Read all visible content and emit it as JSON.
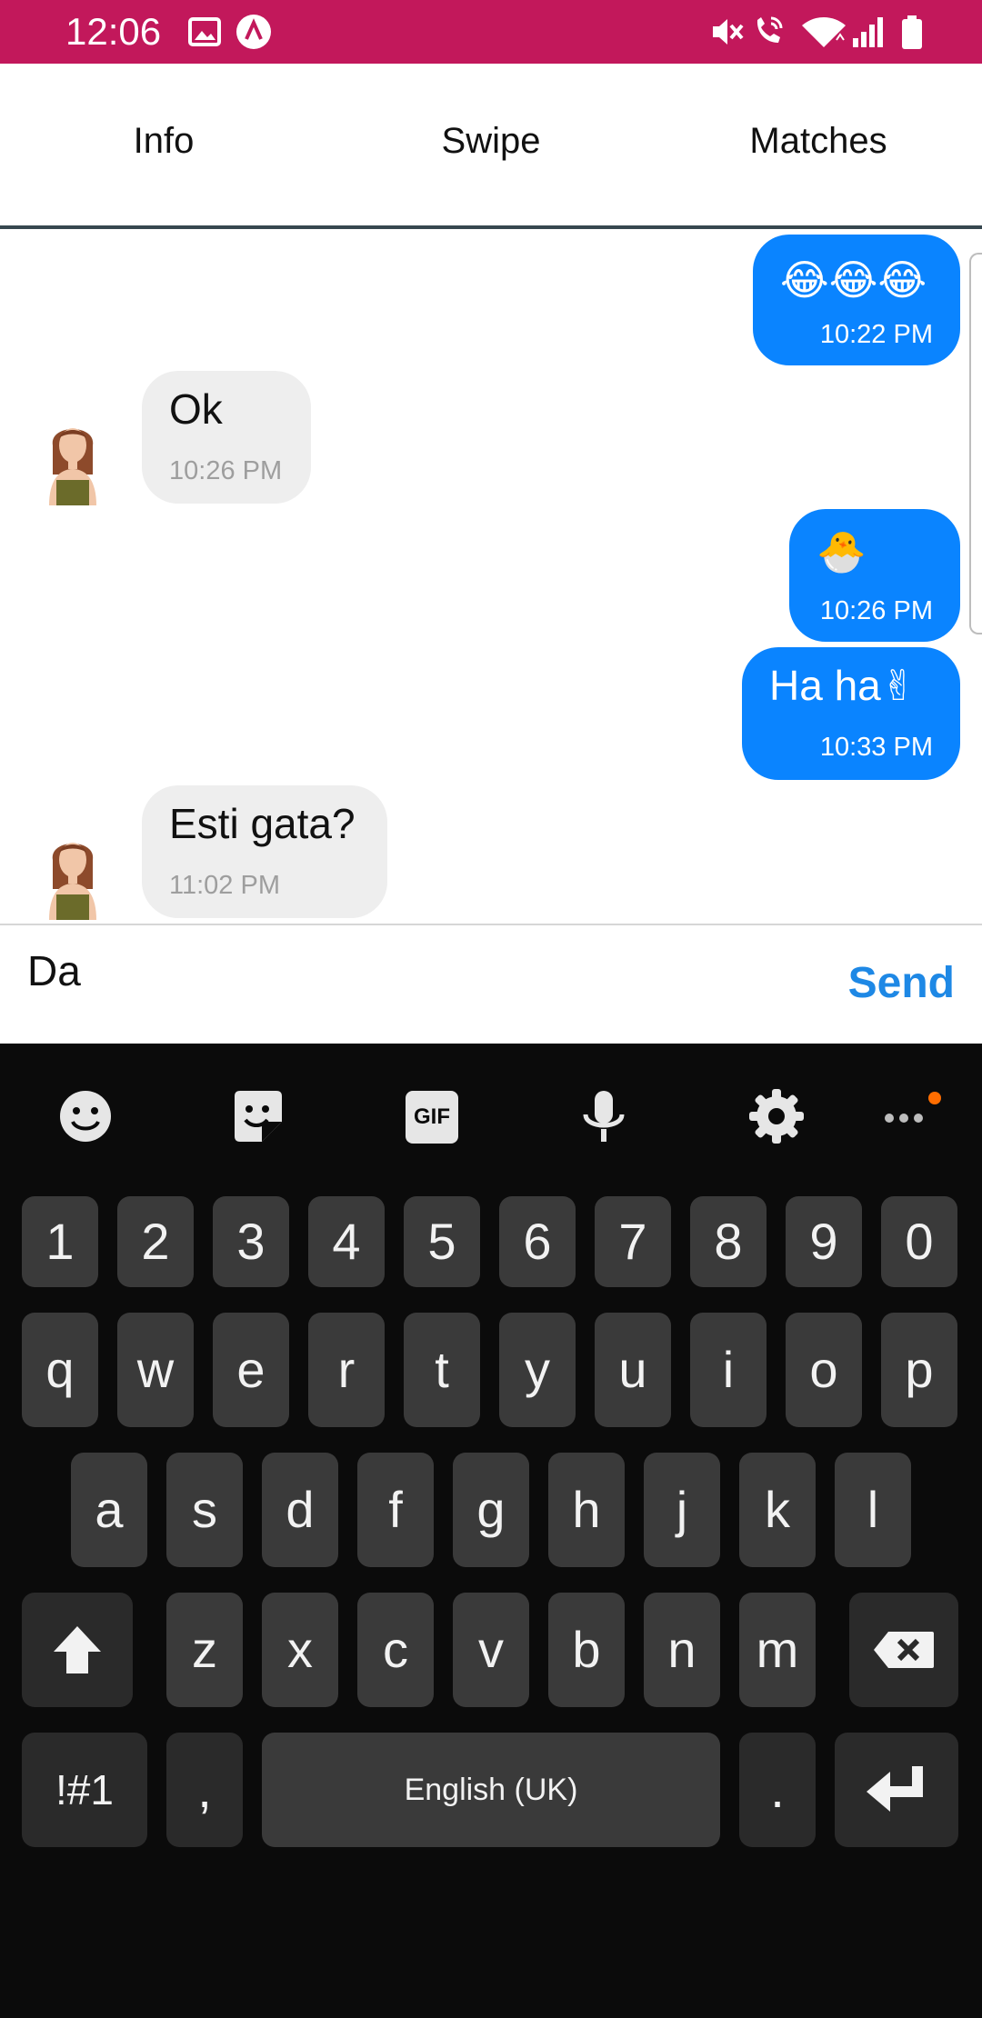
{
  "status_bar": {
    "time": "12:06",
    "color": "#c2185b",
    "icons": [
      "image-icon",
      "autocorrect-a-icon",
      "mute-icon",
      "wifi-calling-icon",
      "wifi-icon",
      "signal-icon",
      "battery-icon"
    ]
  },
  "tabs": [
    {
      "label": "Info"
    },
    {
      "label": "Swipe"
    },
    {
      "label": "Matches"
    }
  ],
  "messages": [
    {
      "direction": "sent",
      "text": "😂😂😂",
      "time": "10:22 PM"
    },
    {
      "direction": "received",
      "text": "Ok",
      "time": "10:26 PM"
    },
    {
      "direction": "sent",
      "text": "🐣",
      "time": "10:26 PM"
    },
    {
      "direction": "sent",
      "text": "Ha ha✌",
      "time": "10:33 PM"
    },
    {
      "direction": "received",
      "text": "Esti gata?",
      "time": "11:02 PM"
    }
  ],
  "compose": {
    "value": "Da",
    "send_label": "Send"
  },
  "keyboard": {
    "toolbar": [
      "emoji-icon",
      "sticker-icon",
      "gif-icon",
      "microphone-icon",
      "settings-icon",
      "more-icon"
    ],
    "gif_label": "GIF",
    "number_row": [
      "1",
      "2",
      "3",
      "4",
      "5",
      "6",
      "7",
      "8",
      "9",
      "0"
    ],
    "row1": [
      "q",
      "w",
      "e",
      "r",
      "t",
      "y",
      "u",
      "i",
      "o",
      "p"
    ],
    "row2": [
      "a",
      "s",
      "d",
      "f",
      "g",
      "h",
      "j",
      "k",
      "l"
    ],
    "row3": [
      "z",
      "x",
      "c",
      "v",
      "b",
      "n",
      "m"
    ],
    "symbols_label": "!#1",
    "comma_label": ",",
    "space_label": "English (UK)",
    "period_label": "."
  },
  "colors": {
    "sent_bubble": "#0a84ff",
    "received_bubble": "#eeeeee",
    "send_text": "#1e88e5",
    "keyboard_bg": "#0b0b0b",
    "key_bg": "#3a3a3a"
  }
}
